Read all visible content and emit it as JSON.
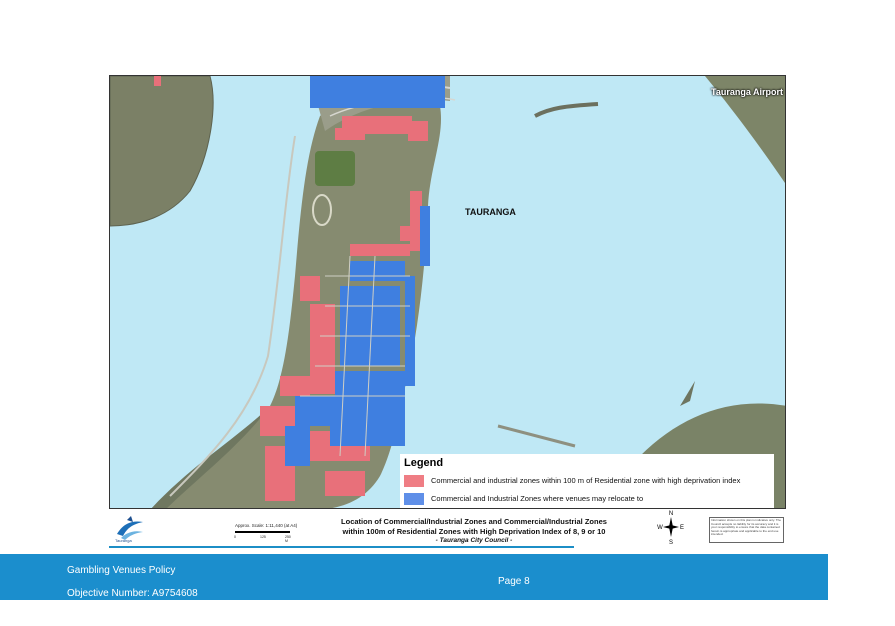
{
  "map": {
    "labels": {
      "airport": "Tauranga Airport",
      "city": "TAURANGA"
    },
    "colors": {
      "water": "#bfe8f5",
      "land": "#7b8066",
      "red_zone": "#e8707a",
      "blue_zone": "#3f7fe0"
    }
  },
  "legend": {
    "title": "Legend",
    "items": [
      {
        "color": "#ef7d84",
        "label": "Commercial and industrial zones within 100 m of Residential zone with high deprivation index"
      },
      {
        "color": "#5f8fe8",
        "label": "Commercial and Industrial Zones where venues may relocate to"
      }
    ]
  },
  "title_block": {
    "logo_caption": "Tauranga",
    "scale": "Approx. Scale: 1:11,440 (at A4)",
    "scale_ticks": [
      "0",
      "125",
      "250 M"
    ],
    "title_line1": "Location of Commercial/Industrial Zones and Commercial/Industrial Zones",
    "title_line2": "within 100m of Residential Zones with High Deprivation Index of 8, 9 or 10",
    "subtitle": "- Tauranga City Council -",
    "compass": {
      "n": "N",
      "s": "S",
      "e": "E",
      "w": "W"
    },
    "disclaimer": "Information shown on this plan is indicative only. The Council accepts no liability for its accuracy and it is your responsibility to ensure that the data contained herein is appropriate and applicable to the end use intended."
  },
  "footer": {
    "policy": "Gambling Venues Policy",
    "objective": "Objective Number: A9754608",
    "page": "Page 8"
  }
}
